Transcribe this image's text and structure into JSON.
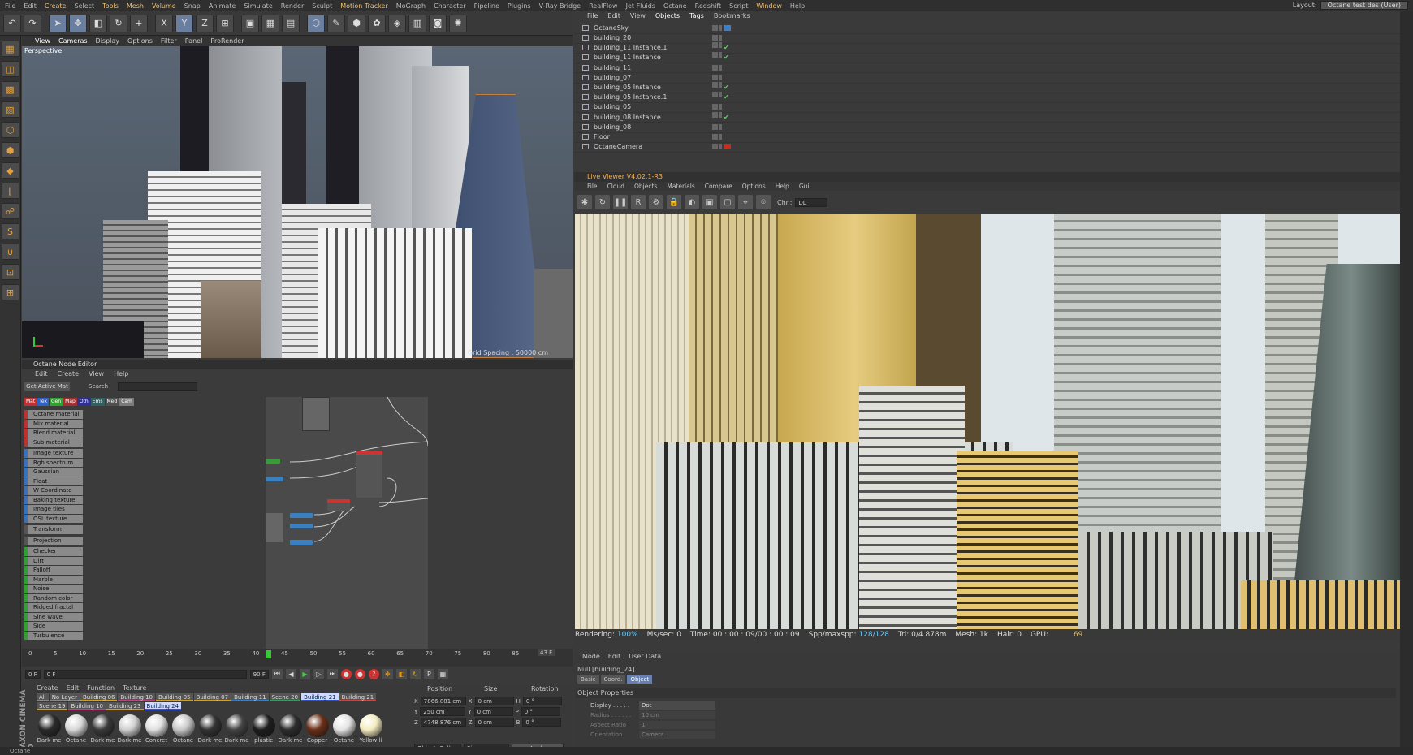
{
  "menubar": {
    "items": [
      "File",
      "Edit",
      "Create",
      "Select",
      "Tools",
      "Mesh",
      "Volume",
      "Snap",
      "Animate",
      "Simulate",
      "Render",
      "Sculpt",
      "Motion Tracker",
      "MoGraph",
      "Character",
      "Pipeline",
      "Plugins",
      "V-Ray Bridge",
      "RealFlow",
      "Jet Fluids",
      "Octane",
      "Redshift",
      "Script",
      "Window",
      "Help"
    ],
    "layout_label": "Layout:",
    "layout_value": "Octane test des (User)"
  },
  "viewport": {
    "menu": [
      "View",
      "Cameras",
      "Display",
      "Options",
      "Filter",
      "Panel",
      "ProRender"
    ],
    "label": "Perspective",
    "grid_spacing": "Grid Spacing : 50000 cm"
  },
  "node_editor": {
    "title": "Octane Node Editor",
    "menu": [
      "Edit",
      "Create",
      "View",
      "Help"
    ],
    "get_active": "Get Active Mat",
    "search_label": "Search",
    "categories": [
      {
        "label": "Mat",
        "color": "#c03030"
      },
      {
        "label": "Tex",
        "color": "#3060c0"
      },
      {
        "label": "Gen",
        "color": "#30a030"
      },
      {
        "label": "Map",
        "color": "#a03030"
      },
      {
        "label": "Oth",
        "color": "#303090"
      },
      {
        "label": "Ems",
        "color": "#306060"
      },
      {
        "label": "Med",
        "color": "#505050"
      },
      {
        "label": "Cam",
        "color": "#7a7a7a"
      }
    ],
    "nodes": [
      {
        "label": "Octane material",
        "color": "#c03030",
        "gap": false
      },
      {
        "label": "Mix material",
        "color": "#c03030",
        "gap": false
      },
      {
        "label": "Blend material",
        "color": "#c03030",
        "gap": false
      },
      {
        "label": "Sub material",
        "color": "#c03030",
        "gap": false
      },
      {
        "label": "Image texture",
        "color": "#3a70c0",
        "gap": true
      },
      {
        "label": "Rgb spectrum",
        "color": "#3a70c0",
        "gap": false
      },
      {
        "label": "Gaussian spectrum",
        "color": "#3a70c0",
        "gap": false
      },
      {
        "label": "Float",
        "color": "#3a70c0",
        "gap": false
      },
      {
        "label": "W Coordinate",
        "color": "#3a70c0",
        "gap": false
      },
      {
        "label": "Baking texture",
        "color": "#3a70c0",
        "gap": false
      },
      {
        "label": "Image tiles",
        "color": "#3a70c0",
        "gap": false
      },
      {
        "label": "OSL texture",
        "color": "#3a70c0",
        "gap": false
      },
      {
        "label": "Transform",
        "color": "#555",
        "gap": true
      },
      {
        "label": "Projection",
        "color": "#555",
        "gap": true
      },
      {
        "label": "Checker",
        "color": "#30a030",
        "gap": true
      },
      {
        "label": "Dirt",
        "color": "#30a030",
        "gap": false
      },
      {
        "label": "Falloff",
        "color": "#30a030",
        "gap": false
      },
      {
        "label": "Marble",
        "color": "#30a030",
        "gap": false
      },
      {
        "label": "Noise",
        "color": "#30a030",
        "gap": false
      },
      {
        "label": "Random color",
        "color": "#30a030",
        "gap": false
      },
      {
        "label": "Ridged fractal",
        "color": "#30a030",
        "gap": false
      },
      {
        "label": "Sine wave",
        "color": "#30a030",
        "gap": false
      },
      {
        "label": "Side",
        "color": "#30a030",
        "gap": false
      },
      {
        "label": "Turbulence",
        "color": "#30a030",
        "gap": false
      }
    ]
  },
  "timeline": {
    "ticks": [
      "0",
      "5",
      "10",
      "15",
      "20",
      "25",
      "30",
      "35",
      "40",
      "45",
      "50",
      "55",
      "60",
      "65",
      "70",
      "75",
      "80",
      "85",
      "90"
    ],
    "current": "43 F",
    "marker": "43.5"
  },
  "transport": {
    "start": "0 F",
    "start2": "0 F",
    "end": "90 F",
    "end2": "90 F"
  },
  "material_manager": {
    "menu": [
      "Create",
      "Edit",
      "Function",
      "Texture"
    ],
    "brand": "MAXON CINEMA 4D",
    "layers": [
      {
        "label": "All",
        "sel": false
      },
      {
        "label": "No Layer",
        "sel": false
      },
      {
        "label": "Building 06",
        "sel": false
      },
      {
        "label": "Building 10",
        "sel": false
      },
      {
        "label": "Building 05",
        "sel": false
      },
      {
        "label": "Building 07",
        "sel": false
      },
      {
        "label": "Building 11",
        "sel": false
      },
      {
        "label": "Scene 20",
        "sel": false
      },
      {
        "label": "Building 21",
        "sel": true
      },
      {
        "label": "Building 21",
        "sel": false
      },
      {
        "label": "Scene 19",
        "sel": false
      },
      {
        "label": "Building 10",
        "sel": false
      },
      {
        "label": "Building 23",
        "sel": false
      },
      {
        "label": "Building 24",
        "sel": true
      }
    ],
    "materials": [
      {
        "label": "Dark me",
        "color": "#2a2a2a"
      },
      {
        "label": "Octane",
        "color": "#d8d8d8"
      },
      {
        "label": "Dark me",
        "color": "#3a3a3a"
      },
      {
        "label": "Dark me",
        "color": "#d0d0d0"
      },
      {
        "label": "Concret",
        "color": "#e0e0e0"
      },
      {
        "label": "Octane",
        "color": "#c8c8c8"
      },
      {
        "label": "Dark me",
        "color": "#333333"
      },
      {
        "label": "Dark me",
        "color": "#444444"
      },
      {
        "label": "plastic",
        "color": "#1e1e1e"
      },
      {
        "label": "Dark me",
        "color": "#2d2d2d"
      },
      {
        "label": "Copper",
        "color": "#6a3018"
      },
      {
        "label": "Octane",
        "color": "#e4e4e4"
      },
      {
        "label": "Yellow li",
        "color": "#f4ecc0"
      }
    ]
  },
  "coord_manager": {
    "headers": [
      "Position",
      "Size",
      "Rotation"
    ],
    "rows": [
      {
        "axis": "X",
        "pos": "7866.881 cm",
        "size": "0 cm",
        "rlab": "H",
        "rot": "0 °"
      },
      {
        "axis": "Y",
        "pos": "250 cm",
        "size": "0 cm",
        "rlab": "P",
        "rot": "0 °"
      },
      {
        "axis": "Z",
        "pos": "4748.876 cm",
        "size": "0 cm",
        "rlab": "B",
        "rot": "0 °"
      }
    ],
    "mode": "Object (Rel)",
    "size_mode": "Size",
    "apply": "Apply"
  },
  "object_manager": {
    "tabs": [
      "File",
      "Edit",
      "View",
      "Objects",
      "Tags",
      "Bookmarks"
    ],
    "objects": [
      {
        "name": "OctaneSky",
        "check": false,
        "tag": "#3a80d0"
      },
      {
        "name": "building_20",
        "check": false,
        "tag": ""
      },
      {
        "name": "building_11 Instance.1",
        "check": true,
        "tag": ""
      },
      {
        "name": "building_11 Instance",
        "check": true,
        "tag": ""
      },
      {
        "name": "building_11",
        "check": false,
        "tag": ""
      },
      {
        "name": "building_07",
        "check": false,
        "tag": ""
      },
      {
        "name": "building_05 Instance",
        "check": true,
        "tag": ""
      },
      {
        "name": "building_05 Instance.1",
        "check": true,
        "tag": ""
      },
      {
        "name": "building_05",
        "check": false,
        "tag": ""
      },
      {
        "name": "building_08 Instance",
        "check": true,
        "tag": ""
      },
      {
        "name": "building_08",
        "check": false,
        "tag": ""
      },
      {
        "name": "Floor",
        "check": false,
        "tag": ""
      },
      {
        "name": "OctaneCamera",
        "check": false,
        "tag": "#c03020"
      }
    ]
  },
  "live_viewer": {
    "title": "Live Viewer V4.02.1-R3",
    "menu": [
      "File",
      "Cloud",
      "Objects",
      "Materials",
      "Compare",
      "Options",
      "Help",
      "Gui"
    ],
    "channel_label": "Chn:",
    "channel": "DL"
  },
  "status": {
    "rendering_label": "Rendering:",
    "rendering": "100%",
    "ms_label": "Ms/sec:",
    "ms": "0",
    "time_label": "Time:",
    "time": "00 : 00 : 09/00 : 00 : 09",
    "spp_label": "Spp/maxspp:",
    "spp": "128/128",
    "tri_label": "Tri:",
    "tri": "0/4.878m",
    "mesh_label": "Mesh:",
    "mesh": "1k",
    "hair_label": "Hair:",
    "hair": "0",
    "gpu_label": "GPU:",
    "gpu": "69"
  },
  "attributes": {
    "tabs": [
      "Mode",
      "Edit",
      "User Data"
    ],
    "title": "Null [building_24]",
    "subtabs": [
      "Basic",
      "Coord.",
      "Object"
    ],
    "section": "Object Properties",
    "props": [
      {
        "label": "Display . . . . .",
        "value": "Dot"
      },
      {
        "label": "Radius . . . . . .",
        "value": "10 cm"
      },
      {
        "label": "Aspect Ratio",
        "value": "1"
      },
      {
        "label": "Orientation",
        "value": "Camera"
      }
    ]
  },
  "footer": "Octane"
}
